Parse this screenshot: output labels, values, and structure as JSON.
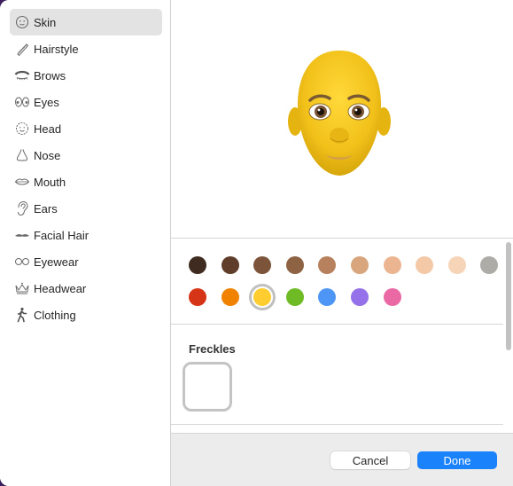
{
  "sidebar": {
    "items": [
      {
        "label": "Skin",
        "icon": "face-icon",
        "active": true
      },
      {
        "label": "Hairstyle",
        "icon": "comb-icon"
      },
      {
        "label": "Brows",
        "icon": "brow-icon"
      },
      {
        "label": "Eyes",
        "icon": "eyes-icon"
      },
      {
        "label": "Head",
        "icon": "head-icon"
      },
      {
        "label": "Nose",
        "icon": "nose-icon"
      },
      {
        "label": "Mouth",
        "icon": "lips-icon"
      },
      {
        "label": "Ears",
        "icon": "ear-icon"
      },
      {
        "label": "Facial Hair",
        "icon": "mustache-icon"
      },
      {
        "label": "Eyewear",
        "icon": "glasses-icon"
      },
      {
        "label": "Headwear",
        "icon": "crown-icon"
      },
      {
        "label": "Clothing",
        "icon": "person-walking-icon"
      }
    ]
  },
  "skin_colors": {
    "row1": [
      "#3f2b20",
      "#5f3d2a",
      "#7b5439",
      "#8d6343",
      "#b6815c",
      "#d9a57c",
      "#ecb592",
      "#f4c9a7",
      "#f5d4b8",
      "#adaca7"
    ],
    "row2": [
      "#d53516",
      "#f08200",
      "#ffcd30",
      "#6fbb25",
      "#4e96f5",
      "#9572e9",
      "#ea69a4"
    ],
    "selected": "#ffcd30"
  },
  "freckles": {
    "title": "Freckles"
  },
  "footer": {
    "cancel_label": "Cancel",
    "done_label": "Done"
  },
  "colors": {
    "accent": "#1a82fb",
    "avatar_skin": "#f5c518"
  }
}
